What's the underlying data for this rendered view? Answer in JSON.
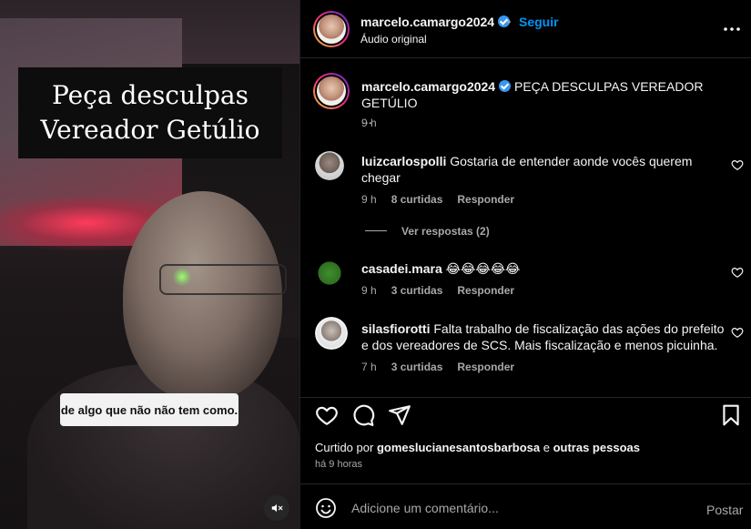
{
  "video": {
    "title_line1": "Peça desculpas",
    "title_line2": "Vereador Getúlio",
    "caption": "de algo que não não tem como.",
    "mute_icon": "speaker-muted-icon"
  },
  "header": {
    "username": "marcelo.camargo2024",
    "separator": "•",
    "follow_label": "Seguir",
    "audio": "Áudio original"
  },
  "post_caption": {
    "username": "marcelo.camargo2024",
    "text": "PEÇA DESCULPAS VEREADOR GETÚLIO",
    "ellipsis": "...",
    "time": "9 h"
  },
  "comments": [
    {
      "username": "luizcarlospolli",
      "text": "Gostaria de entender aonde vocês querem chegar",
      "time": "9 h",
      "likes": "8 curtidas",
      "reply": "Responder",
      "view_replies": "Ver respostas (2)"
    },
    {
      "username": "casadei.mara",
      "text": "😂😂😂😂😂",
      "time": "9 h",
      "likes": "3 curtidas",
      "reply": "Responder"
    },
    {
      "username": "silasfiorotti",
      "text": "Falta trabalho de fiscalização das ações do prefeito e dos vereadores de SCS. Mais fiscalização e menos picuinha.",
      "time": "7 h",
      "likes": "3 curtidas",
      "reply": "Responder"
    }
  ],
  "likes_line": {
    "prefix": "Curtido por",
    "user": "gomeslucianesantosbarbosa",
    "and": "e",
    "others": "outras pessoas"
  },
  "posted_ago": "há 9 horas",
  "add_comment": {
    "placeholder": "Adicione um comentário...",
    "post_label": "Postar"
  },
  "colors": {
    "link_blue": "#0095f6",
    "verified_blue": "#3897f0",
    "secondary_text": "#a8a8a8"
  }
}
